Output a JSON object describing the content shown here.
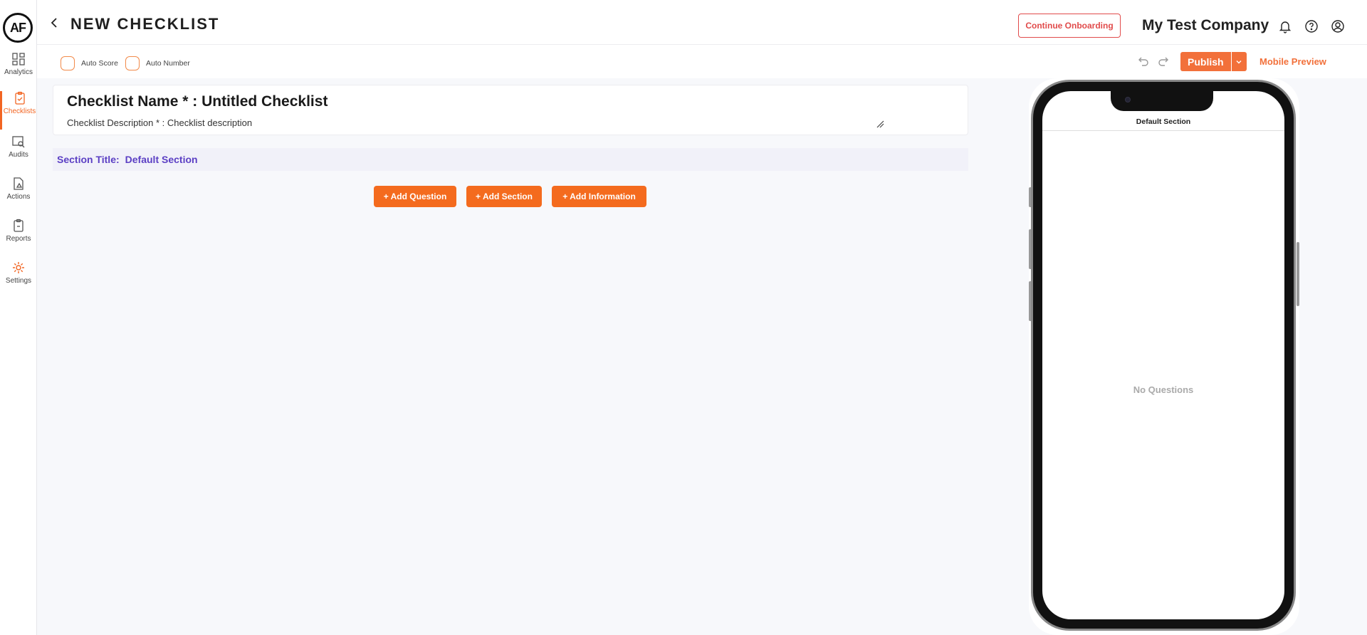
{
  "brand": {
    "logo_text": "AF",
    "accent": "#f26522"
  },
  "sidebar": {
    "items": [
      {
        "label": "Analytics",
        "icon": "analytics-icon"
      },
      {
        "label": "Checklists",
        "icon": "checklist-icon",
        "active": true
      },
      {
        "label": "Audits",
        "icon": "audit-icon"
      },
      {
        "label": "Actions",
        "icon": "action-icon"
      },
      {
        "label": "Reports",
        "icon": "report-icon"
      },
      {
        "label": "Settings",
        "icon": "gear-icon"
      }
    ]
  },
  "header": {
    "title": "NEW CHECKLIST",
    "onboarding_label": "Continue Onboarding",
    "company": "My Test Company"
  },
  "toolbar": {
    "auto_score": "Auto Score",
    "auto_number": "Auto Number",
    "publish_label": "Publish",
    "mobile_preview_label": "Mobile Preview"
  },
  "checklist": {
    "name_line": "Checklist Name * : Untitled Checklist",
    "description_line": "Checklist Description * : Checklist description"
  },
  "section": {
    "title_label": "Section Title:",
    "title_value": "Default Section"
  },
  "actions": {
    "add_question": "+ Add Question",
    "add_section": "+ Add Section",
    "add_information": "+ Add Information"
  },
  "preview": {
    "section_title": "Default Section",
    "empty_text": "No Questions"
  }
}
